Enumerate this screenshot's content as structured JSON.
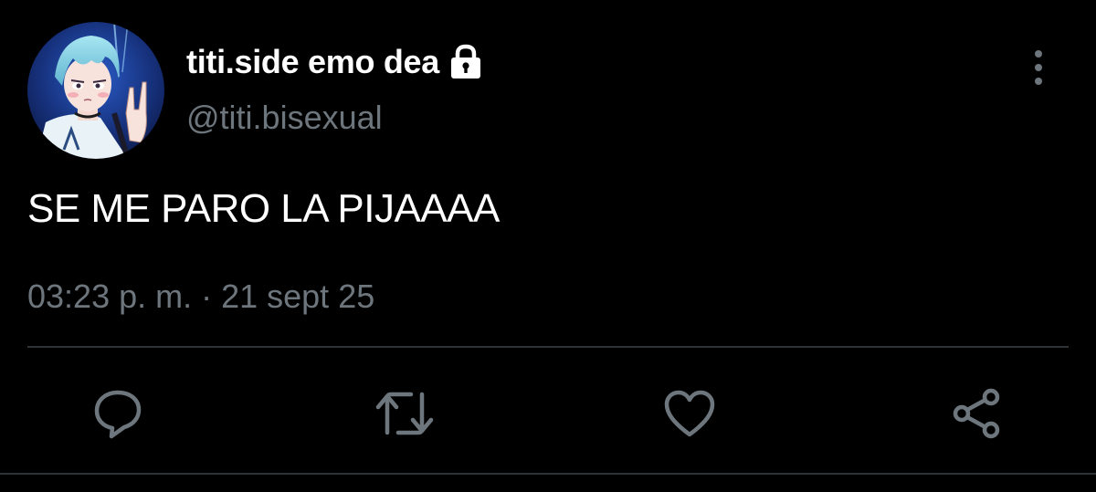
{
  "tweet": {
    "display_name": "titi.side emo dea",
    "handle": "@titi.bisexual",
    "text": "SE ME PARO LA PIJAAAA",
    "timestamp": "03:23 p. m. · 21 sept 25",
    "protected_icon": "lock-icon",
    "more_icon": "more-vertical-icon"
  },
  "actions": [
    {
      "name": "reply",
      "icon": "reply-icon"
    },
    {
      "name": "retweet",
      "icon": "retweet-icon"
    },
    {
      "name": "like",
      "icon": "heart-icon"
    },
    {
      "name": "share",
      "icon": "share-icon"
    }
  ],
  "colors": {
    "background": "#000000",
    "primary_text": "#ffffff",
    "secondary_text": "#6e767d",
    "divider": "#2f3336",
    "icon": "#6e767d"
  }
}
